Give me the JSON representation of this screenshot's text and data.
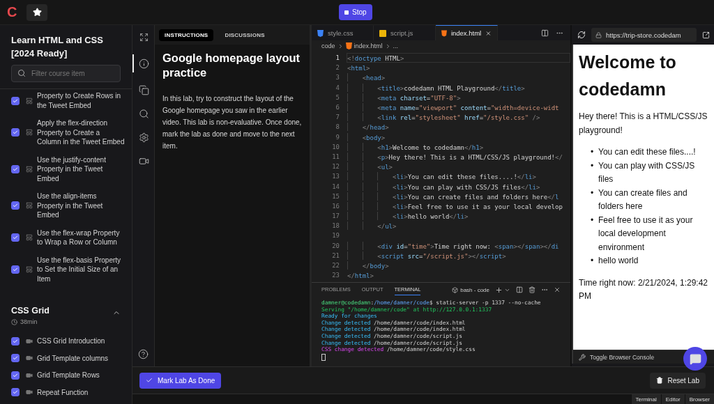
{
  "topbar": {
    "logo": "C",
    "stop_button": "Stop"
  },
  "sidebar": {
    "title": "Learn HTML and CSS [2024 Ready]",
    "search": {
      "placeholder": "Filter course item"
    },
    "sections": [
      {
        "items": [
          {
            "label": "Property to Create Rows in the Tweet Embed",
            "kind": "lab",
            "checked": true
          },
          {
            "label": "Apply the flex-direction Property to Create a Column in the Tweet Embed",
            "kind": "lab",
            "checked": true
          },
          {
            "label": "Use the justify-content Property in the Tweet Embed",
            "kind": "lab",
            "checked": true
          },
          {
            "label": "Use the align-items Property in the Tweet Embed",
            "kind": "lab",
            "checked": true
          },
          {
            "label": "Use the flex-wrap Property to Wrap a Row or Column",
            "kind": "lab",
            "checked": true
          },
          {
            "label": "Use the flex-basis Property to Set the Initial Size of an Item",
            "kind": "lab",
            "checked": true
          }
        ]
      },
      {
        "title": "CSS Grid",
        "duration": "38min",
        "expanded": true,
        "items": [
          {
            "label": "CSS Grid Introduction",
            "kind": "video",
            "checked": true
          },
          {
            "label": "Grid Template columns",
            "kind": "video",
            "checked": true
          },
          {
            "label": "Grid Template Rows",
            "kind": "video",
            "checked": true
          },
          {
            "label": "Repeat Function",
            "kind": "video",
            "checked": true
          }
        ]
      }
    ]
  },
  "rail": [
    {
      "kind": "expand",
      "selected": false
    },
    {
      "kind": "info",
      "selected": true
    },
    {
      "kind": "files",
      "selected": false
    },
    {
      "kind": "search",
      "selected": false
    },
    {
      "kind": "settings",
      "selected": false
    },
    {
      "kind": "video",
      "selected": false
    }
  ],
  "instructions": {
    "tabs": [
      {
        "label": "INSTRUCTIONS",
        "selected": true
      },
      {
        "label": "DISCUSSIONS",
        "selected": false
      }
    ],
    "heading": "Google homepage layout practice",
    "body": "In this lab, try to construct the layout of the Google homepage you saw in the earlier video. This lab is non-evaluative. Once done, mark the lab as done and move to the next item."
  },
  "editor": {
    "tabs": [
      {
        "label": "style.css",
        "kind": "css",
        "selected": false
      },
      {
        "label": "script.js",
        "kind": "js",
        "selected": false
      },
      {
        "label": "index.html",
        "kind": "html",
        "selected": true
      }
    ],
    "breadcrumb": [
      {
        "label": "code",
        "kind": "folder"
      },
      {
        "label": "index.html",
        "kind": "html"
      },
      {
        "label": "...",
        "kind": "more"
      }
    ],
    "lines": [
      {
        "n": "1",
        "active": true,
        "tokens": [
          {
            "kind": "punct",
            "text": "<!"
          },
          {
            "kind": "tag",
            "text": "doctype"
          },
          {
            "kind": "text",
            "text": " HTML"
          },
          {
            "kind": "punct",
            "text": ">"
          }
        ]
      },
      {
        "n": "2",
        "active": false,
        "tokens": [
          {
            "kind": "punct",
            "text": "<"
          },
          {
            "kind": "tag",
            "text": "html"
          },
          {
            "kind": "punct",
            "text": ">"
          }
        ]
      },
      {
        "n": "3",
        "active": false,
        "tokens": [
          {
            "kind": "punct",
            "text": "    <"
          },
          {
            "kind": "tag",
            "text": "head"
          },
          {
            "kind": "punct",
            "text": ">"
          }
        ]
      },
      {
        "n": "4",
        "active": false,
        "tokens": [
          {
            "kind": "punct",
            "text": "        <"
          },
          {
            "kind": "tag",
            "text": "title"
          },
          {
            "kind": "punct",
            "text": ">"
          },
          {
            "kind": "text",
            "text": "codedamn HTML Playground"
          },
          {
            "kind": "punct",
            "text": "</"
          },
          {
            "kind": "tag",
            "text": "title"
          },
          {
            "kind": "punct",
            "text": ">"
          }
        ]
      },
      {
        "n": "5",
        "active": false,
        "tokens": [
          {
            "kind": "punct",
            "text": "        <"
          },
          {
            "kind": "tag",
            "text": "meta"
          },
          {
            "kind": "attr",
            "text": " charset"
          },
          {
            "kind": "text",
            "text": "="
          },
          {
            "kind": "string",
            "text": "\"UTF-8\""
          },
          {
            "kind": "punct",
            "text": ">"
          }
        ]
      },
      {
        "n": "6",
        "active": false,
        "tokens": [
          {
            "kind": "punct",
            "text": "        <"
          },
          {
            "kind": "tag",
            "text": "meta"
          },
          {
            "kind": "attr",
            "text": " name"
          },
          {
            "kind": "text",
            "text": "="
          },
          {
            "kind": "string",
            "text": "\"viewport\""
          },
          {
            "kind": "attr",
            "text": " content"
          },
          {
            "kind": "text",
            "text": "="
          },
          {
            "kind": "string",
            "text": "\"width=device-widt"
          }
        ]
      },
      {
        "n": "7",
        "active": false,
        "tokens": [
          {
            "kind": "punct",
            "text": "        <"
          },
          {
            "kind": "tag",
            "text": "link"
          },
          {
            "kind": "attr",
            "text": " rel"
          },
          {
            "kind": "text",
            "text": "="
          },
          {
            "kind": "string",
            "text": "\"stylesheet\""
          },
          {
            "kind": "attr",
            "text": " href"
          },
          {
            "kind": "text",
            "text": "="
          },
          {
            "kind": "string",
            "text": "\"/style.css\""
          },
          {
            "kind": "punct",
            "text": " />"
          }
        ]
      },
      {
        "n": "8",
        "active": false,
        "tokens": [
          {
            "kind": "punct",
            "text": "    </"
          },
          {
            "kind": "tag",
            "text": "head"
          },
          {
            "kind": "punct",
            "text": ">"
          }
        ]
      },
      {
        "n": "9",
        "active": false,
        "tokens": [
          {
            "kind": "punct",
            "text": "    <"
          },
          {
            "kind": "tag",
            "text": "body"
          },
          {
            "kind": "punct",
            "text": ">"
          }
        ]
      },
      {
        "n": "10",
        "active": false,
        "tokens": [
          {
            "kind": "punct",
            "text": "        <"
          },
          {
            "kind": "tag",
            "text": "h1"
          },
          {
            "kind": "punct",
            "text": ">"
          },
          {
            "kind": "text",
            "text": "Welcome to codedamn"
          },
          {
            "kind": "punct",
            "text": "</"
          },
          {
            "kind": "tag",
            "text": "h1"
          },
          {
            "kind": "punct",
            "text": ">"
          }
        ]
      },
      {
        "n": "11",
        "active": false,
        "tokens": [
          {
            "kind": "punct",
            "text": "        <"
          },
          {
            "kind": "tag",
            "text": "p"
          },
          {
            "kind": "punct",
            "text": ">"
          },
          {
            "kind": "text",
            "text": "Hey there! This is a HTML/CSS/JS playground!"
          },
          {
            "kind": "punct",
            "text": "</"
          }
        ]
      },
      {
        "n": "12",
        "active": false,
        "tokens": [
          {
            "kind": "punct",
            "text": "        <"
          },
          {
            "kind": "tag",
            "text": "ul"
          },
          {
            "kind": "punct",
            "text": ">"
          }
        ]
      },
      {
        "n": "13",
        "active": false,
        "tokens": [
          {
            "kind": "punct",
            "text": "            <"
          },
          {
            "kind": "tag",
            "text": "li"
          },
          {
            "kind": "punct",
            "text": ">"
          },
          {
            "kind": "text",
            "text": "You can edit these files....!"
          },
          {
            "kind": "punct",
            "text": "</"
          },
          {
            "kind": "tag",
            "text": "li"
          },
          {
            "kind": "punct",
            "text": ">"
          }
        ]
      },
      {
        "n": "14",
        "active": false,
        "tokens": [
          {
            "kind": "punct",
            "text": "            <"
          },
          {
            "kind": "tag",
            "text": "li"
          },
          {
            "kind": "punct",
            "text": ">"
          },
          {
            "kind": "text",
            "text": "You can play with CSS/JS files"
          },
          {
            "kind": "punct",
            "text": "</"
          },
          {
            "kind": "tag",
            "text": "li"
          },
          {
            "kind": "punct",
            "text": ">"
          }
        ]
      },
      {
        "n": "15",
        "active": false,
        "tokens": [
          {
            "kind": "punct",
            "text": "            <"
          },
          {
            "kind": "tag",
            "text": "li"
          },
          {
            "kind": "punct",
            "text": ">"
          },
          {
            "kind": "text",
            "text": "You can create files and folders here"
          },
          {
            "kind": "punct",
            "text": "</"
          },
          {
            "kind": "tag",
            "text": "l"
          }
        ]
      },
      {
        "n": "16",
        "active": false,
        "tokens": [
          {
            "kind": "punct",
            "text": "            <"
          },
          {
            "kind": "tag",
            "text": "li"
          },
          {
            "kind": "punct",
            "text": ">"
          },
          {
            "kind": "text",
            "text": "Feel free to use it as your local develop"
          }
        ]
      },
      {
        "n": "17",
        "active": false,
        "tokens": [
          {
            "kind": "punct",
            "text": "            <"
          },
          {
            "kind": "tag",
            "text": "li"
          },
          {
            "kind": "punct",
            "text": ">"
          },
          {
            "kind": "text",
            "text": "hello world"
          },
          {
            "kind": "punct",
            "text": "</"
          },
          {
            "kind": "tag",
            "text": "li"
          },
          {
            "kind": "punct",
            "text": ">"
          }
        ]
      },
      {
        "n": "18",
        "active": false,
        "tokens": [
          {
            "kind": "punct",
            "text": "        </"
          },
          {
            "kind": "tag",
            "text": "ul"
          },
          {
            "kind": "punct",
            "text": ">"
          }
        ]
      },
      {
        "n": "19",
        "active": false
      },
      {
        "n": "20",
        "active": false,
        "tokens": [
          {
            "kind": "punct",
            "text": "        <"
          },
          {
            "kind": "tag",
            "text": "div"
          },
          {
            "kind": "attr",
            "text": " id"
          },
          {
            "kind": "text",
            "text": "="
          },
          {
            "kind": "string",
            "text": "\"time\""
          },
          {
            "kind": "punct",
            "text": ">"
          },
          {
            "kind": "text",
            "text": "Time right now: "
          },
          {
            "kind": "punct",
            "text": "<"
          },
          {
            "kind": "tag",
            "text": "span"
          },
          {
            "kind": "punct",
            "text": "></"
          },
          {
            "kind": "tag",
            "text": "span"
          },
          {
            "kind": "punct",
            "text": "></"
          },
          {
            "kind": "tag",
            "text": "di"
          }
        ]
      },
      {
        "n": "21",
        "active": false,
        "tokens": [
          {
            "kind": "punct",
            "text": "        <"
          },
          {
            "kind": "tag",
            "text": "script"
          },
          {
            "kind": "attr",
            "text": " src"
          },
          {
            "kind": "text",
            "text": "="
          },
          {
            "kind": "string",
            "text": "\"/script.js\""
          },
          {
            "kind": "punct",
            "text": "></"
          },
          {
            "kind": "tag",
            "text": "script"
          },
          {
            "kind": "punct",
            "text": ">"
          }
        ]
      },
      {
        "n": "22",
        "active": false,
        "tokens": [
          {
            "kind": "punct",
            "text": "    </"
          },
          {
            "kind": "tag",
            "text": "body"
          },
          {
            "kind": "punct",
            "text": ">"
          }
        ]
      },
      {
        "n": "23",
        "active": false,
        "tokens": [
          {
            "kind": "punct",
            "text": "</"
          },
          {
            "kind": "tag",
            "text": "html"
          },
          {
            "kind": "punct",
            "text": ">"
          }
        ]
      }
    ]
  },
  "terminal": {
    "tabs": [
      {
        "label": "PROBLEMS",
        "selected": false
      },
      {
        "label": "OUTPUT",
        "selected": false
      },
      {
        "label": "TERMINAL",
        "selected": true
      }
    ],
    "shell": "bash - code",
    "lines": [
      [
        {
          "kind": "prompt",
          "text": "damner@codedamn"
        },
        {
          "kind": "plain",
          "text": ":"
        },
        {
          "kind": "path",
          "text": "/home/damner/code"
        },
        {
          "kind": "plain",
          "text": "$ static-server -p 1337 --no-cache"
        }
      ],
      [
        {
          "kind": "success",
          "text": "Serving \"/home/damner/code\" at http://127.0.0.1:1337"
        }
      ],
      [
        {
          "kind": "info",
          "text": "Ready for changes"
        }
      ],
      [
        {
          "kind": "info",
          "text": "Change detected"
        },
        {
          "kind": "plain",
          "text": " /home/damner/code/index.html"
        }
      ],
      [
        {
          "kind": "info",
          "text": "Change detected"
        },
        {
          "kind": "plain",
          "text": " /home/damner/code/index.html"
        }
      ],
      [
        {
          "kind": "info",
          "text": "Change detected"
        },
        {
          "kind": "plain",
          "text": " /home/damner/code/script.js"
        }
      ],
      [
        {
          "kind": "info",
          "text": "Change detected"
        },
        {
          "kind": "plain",
          "text": " /home/damner/code/script.js"
        }
      ],
      [
        {
          "kind": "css",
          "text": "CSS change detected"
        },
        {
          "kind": "plain",
          "text": " /home/damner/code/style.css"
        }
      ]
    ]
  },
  "browser": {
    "url": "https://trip-store.codedam",
    "page": {
      "heading": "Welcome to codedamn",
      "paragraph": "Hey there! This is a HTML/CSS/JS playground!",
      "list": [
        {
          "bullet": "•",
          "text": "You can edit these files....!"
        },
        {
          "bullet": "•",
          "text": "You can play with CSS/JS files"
        },
        {
          "bullet": "•",
          "text": "You can create files and folders here"
        },
        {
          "bullet": "•",
          "text": "Feel free to use it as your local development environment"
        },
        {
          "bullet": "•",
          "text": "hello world"
        }
      ],
      "time": "Time right now: 2/21/2024, 1:29:42 PM"
    },
    "console_toggle": "Toggle Browser Console"
  },
  "actions": {
    "mark_done": "Mark Lab As Done",
    "reset": "Reset Lab"
  },
  "footer_tabs": [
    "Terminal",
    "Editor",
    "Browser"
  ]
}
